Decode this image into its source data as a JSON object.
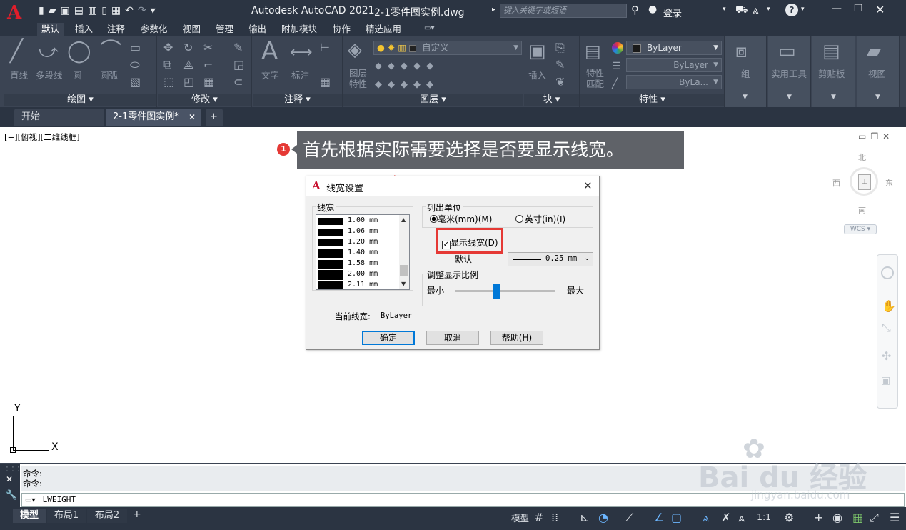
{
  "app": {
    "title": "Autodesk AutoCAD 2021",
    "document": "2-1零件图实例.dwg",
    "search_placeholder": "键入关键字或短语",
    "login": "登录",
    "logo": "A"
  },
  "ribbon_tabs": [
    "默认",
    "插入",
    "注释",
    "参数化",
    "视图",
    "管理",
    "输出",
    "附加模块",
    "协作",
    "精选应用"
  ],
  "ribbon": {
    "draw": {
      "title": "绘图",
      "line": "直线",
      "polyline": "多段线",
      "circle": "圆",
      "arc": "圆弧"
    },
    "modify": {
      "title": "修改"
    },
    "annotation": {
      "title": "注释",
      "text": "文字",
      "dimension": "标注"
    },
    "layers": {
      "title": "图层",
      "layer_props": "图层\n特性",
      "current_layer": "自定义"
    },
    "block": {
      "title": "块",
      "insert": "插入"
    },
    "properties": {
      "title": "特性",
      "match": "特性\n匹配",
      "color": "ByLayer",
      "linetype": "ByLayer",
      "lineweight": "ByLa..."
    },
    "group": "组",
    "utilities": "实用工具",
    "clipboard": "剪贴板",
    "view": "视图"
  },
  "file_tabs": {
    "start": "开始",
    "doc": "2-1零件图实例*"
  },
  "viewport": {
    "label": "[−][俯视][二维线框]",
    "compass": {
      "north": "北",
      "south": "南",
      "east": "东",
      "west": "西",
      "wcs": "WCS"
    },
    "ucs": {
      "x": "X",
      "y": "Y"
    }
  },
  "callout": {
    "number": "1",
    "text": "首先根据实际需要选择是否要显示线宽。"
  },
  "dialog": {
    "title": "线宽设置",
    "lineweights_title": "线宽",
    "lineweights": [
      "1.00 mm",
      "1.06 mm",
      "1.20 mm",
      "1.40 mm",
      "1.58 mm",
      "2.00 mm",
      "2.11 mm"
    ],
    "units_title": "列出单位",
    "units_mm": "毫米(mm)(M)",
    "units_in": "英寸(in)(I)",
    "units_selected": "mm",
    "display_lineweight": "显示线宽(D)",
    "display_lineweight_checked": true,
    "default_label": "默认",
    "default_value": "0.25 mm",
    "scale_title": "调整显示比例",
    "scale_min": "最小",
    "scale_max": "最大",
    "scale_level": 0.4,
    "current_label": "当前线宽:",
    "current_value": "ByLayer",
    "ok": "确定",
    "cancel": "取消",
    "help": "帮助(H)"
  },
  "command": {
    "history": [
      "命令:",
      "命令:"
    ],
    "current": "_LWEIGHT"
  },
  "layout_tabs": [
    "模型",
    "布局1",
    "布局2"
  ],
  "status": {
    "model": "模型",
    "scale": "1:1"
  },
  "watermark": {
    "brand": "Bai du 经验",
    "url": "jingyan.baidu.com"
  },
  "colors": {
    "dark_bg": "#2b3442",
    "ribbon_bg": "#3b4453",
    "accent": "#c8102e",
    "highlight": "#e53935",
    "slider": "#0078d7"
  }
}
